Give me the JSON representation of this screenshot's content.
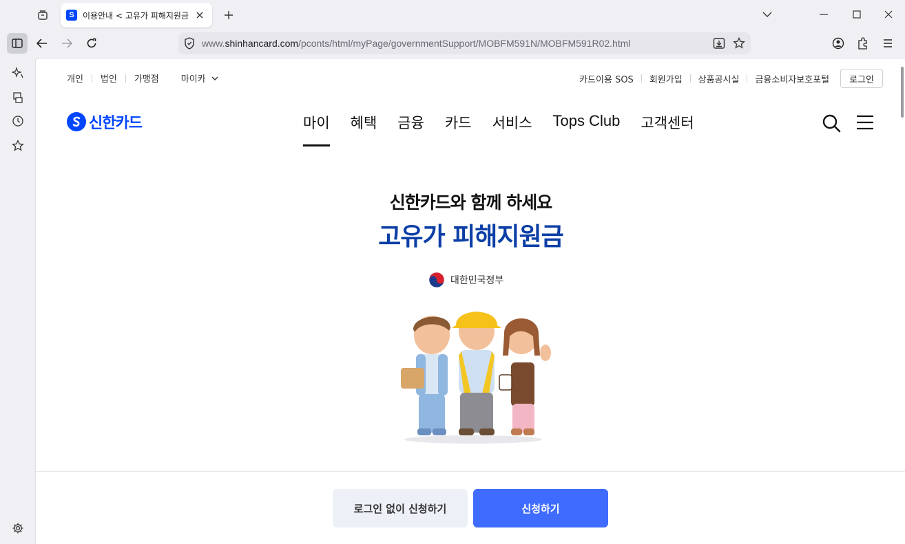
{
  "browser": {
    "tab_title": "이용안내 < 고유가 피해지원금",
    "url_prefix": "www.",
    "url_host": "shinhancard.com",
    "url_path": "/pconts/html/myPage/governmentSupport/MOBFM591N/MOBFM591R02.html"
  },
  "util_nav": {
    "left": [
      "개인",
      "법인",
      "가맹점"
    ],
    "myca": "마이카",
    "right": [
      "카드이용 SOS",
      "회원가입",
      "상품공시실",
      "금융소비자보호포털"
    ],
    "login": "로그인"
  },
  "logo": {
    "text": "신한카드",
    "color": "#0046ff"
  },
  "gnb": [
    "마이",
    "혜택",
    "금융",
    "카드",
    "서비스",
    "Tops Club",
    "고객센터"
  ],
  "hero": {
    "subtitle": "신한카드와 함께 하세요",
    "title": "고유가 피해지원금",
    "gov_label": "대한민국정부",
    "title_color": "#0b3fa6"
  },
  "actions": {
    "guest_apply": "로그인 없이 신청하기",
    "apply": "신청하기",
    "apply_color": "#3f6bff"
  }
}
